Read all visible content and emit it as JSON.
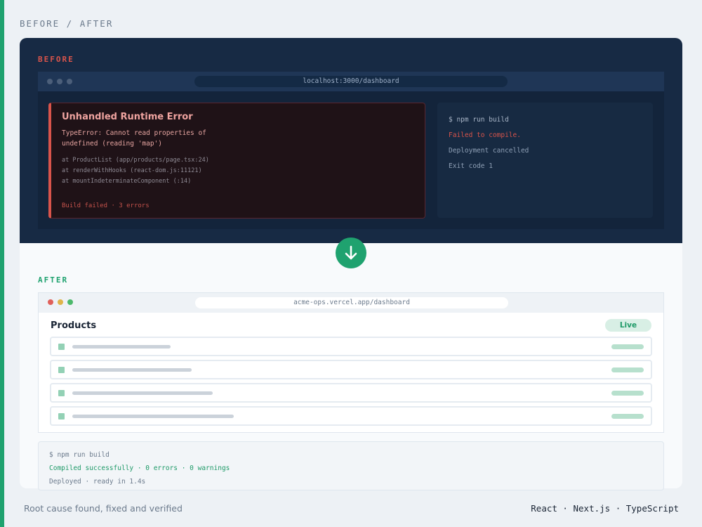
{
  "page_label": "BEFORE / AFTER",
  "before": {
    "label": "BEFORE",
    "url": "localhost:3000/dashboard",
    "error": {
      "title": "Unhandled Runtime Error",
      "message": "TypeError: Cannot read properties of undefined (reading 'map')",
      "stack": [
        "at ProductList (app/products/page.tsx:24)",
        "at renderWithHooks (react-dom.js:11121)",
        "at mountIndeterminateComponent (:14)"
      ],
      "footer": "Build failed · 3 errors"
    },
    "terminal": {
      "command": "$ npm run build",
      "status": "Failed to compile.",
      "line3": "Deployment cancelled",
      "line4": "Exit code 1"
    }
  },
  "arrow_icon": "arrow-down-icon",
  "after": {
    "label": "AFTER",
    "url": "acme-ops.vercel.app/dashboard",
    "title": "Products",
    "badge": "Live",
    "terminal": {
      "command": "$ npm run build",
      "status": "Compiled successfully · 0 errors · 0 warnings",
      "deploy": "Deployed · ready in 1.4s"
    }
  },
  "footer": {
    "caption": "Root cause found, fixed and verified",
    "stack": "React · Next.js · TypeScript"
  },
  "colors": {
    "accent": "#1fa26f",
    "error": "#d9544b",
    "dark_panel": "#172a44"
  }
}
